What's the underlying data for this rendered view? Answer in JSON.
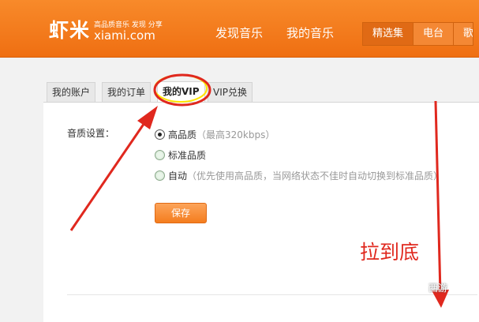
{
  "header": {
    "logo_cn": "虾米",
    "logo_slogan": "高品质音乐 发现 分享",
    "logo_domain": "xiami.com",
    "nav_links": [
      "发现音乐",
      "我的音乐"
    ],
    "nav_tabs": [
      "精选集",
      "电台",
      "歌"
    ]
  },
  "account_tabs": [
    "我的账户",
    "我的订单",
    "我的VIP",
    "VIP兑换"
  ],
  "quality": {
    "label": "音质设置：",
    "options": [
      {
        "name": "高品质",
        "hint": "（最高320kbps）",
        "checked": true
      },
      {
        "name": "标准品质",
        "hint": "",
        "checked": false
      },
      {
        "name": "自动",
        "hint": "（优先使用高品质，当网络状态不佳时自动切换到标准品质）",
        "checked": false
      }
    ],
    "save_label": "保存"
  },
  "annotation": {
    "text": "拉到底",
    "watermark": "西游",
    "color": "#e0281e"
  },
  "colors": {
    "brand": "#f47d1e",
    "annotation_red": "#e0281e",
    "highlight_yellow": "#ffe600"
  }
}
